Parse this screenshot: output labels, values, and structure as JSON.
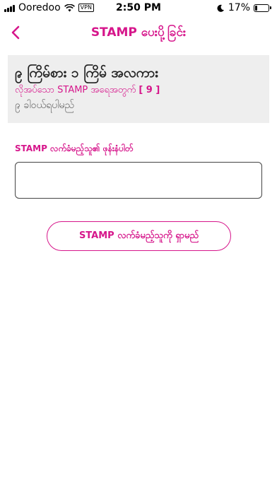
{
  "status_bar": {
    "carrier": "Ooredoo",
    "vpn": "VPN",
    "time": "2:50 PM",
    "battery": "17%",
    "battery_level": 0.17,
    "icons": [
      "signal-icon",
      "wifi-icon",
      "moon-icon",
      "battery-icon"
    ]
  },
  "nav": {
    "back_icon": "chevron-left-icon",
    "title": "STAMP ပေးပို့ခြင်း"
  },
  "card": {
    "title": "၉ ကြိမ်စား ၁ ကြိမ် အလကား",
    "required_label": "လိုအပ်သော STAMP အရေအတွက်",
    "required_count": "[ 9 ]",
    "subtitle": "၉ ခါဝယ်ရပါမည်"
  },
  "form": {
    "phone_label": "STAMP လက်ခံမည့်သူ၏ ဖုန်းနံပါတ်",
    "phone_value": "",
    "phone_placeholder": ""
  },
  "actions": {
    "search_label": "STAMP လက်ခံမည့်သူကို ရှာမည်"
  },
  "colors": {
    "accent": "#d6168b",
    "card_bg": "#eeeeee"
  }
}
